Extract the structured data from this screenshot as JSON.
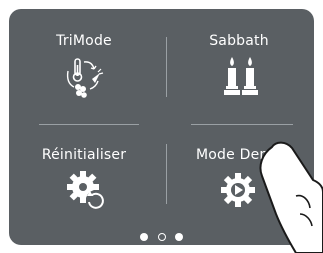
{
  "menu": {
    "tiles": [
      {
        "label": "TriMode",
        "icon": "trimode-temperature-icon"
      },
      {
        "label": "Sabbath",
        "icon": "candles-icon"
      },
      {
        "label": "Réinitialiser",
        "icon": "gear-refresh-icon"
      },
      {
        "label": "Mode Demo",
        "icon": "gear-play-icon"
      }
    ]
  },
  "pagination": {
    "current_page": 2,
    "total_pages": 3
  },
  "colors": {
    "panel": "#5a5f63",
    "foreground": "#ffffff"
  }
}
